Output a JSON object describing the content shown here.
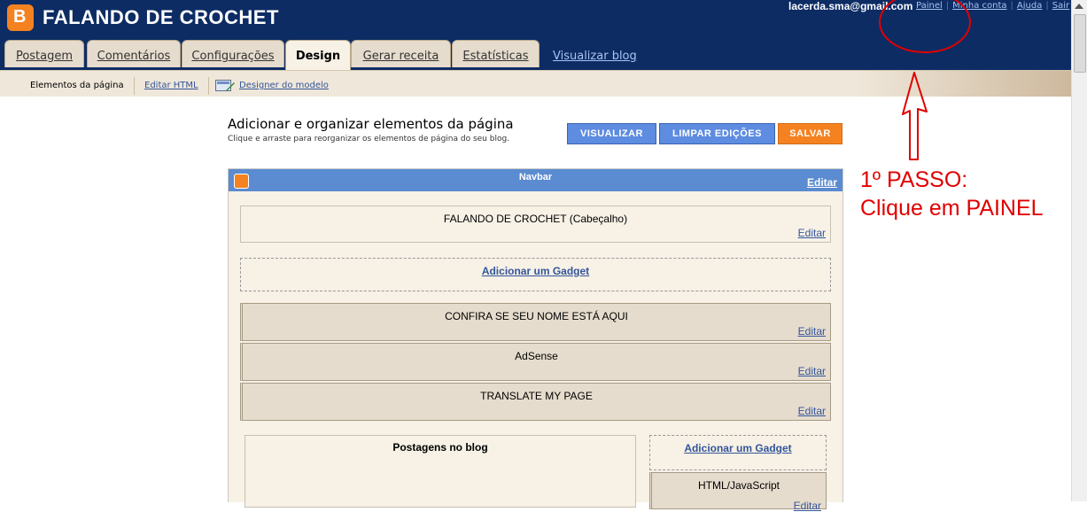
{
  "header": {
    "blog_title": "FALANDO DE CROCHET",
    "user_email": "lacerda.sma@gmail.com",
    "top_links": [
      "Painel",
      "Minha conta",
      "Ajuda",
      "Sair"
    ],
    "tabs": [
      "Postagem",
      "Comentários",
      "Configurações",
      "Design",
      "Gerar receita",
      "Estatísticas"
    ],
    "active_tab": "Design",
    "view_blog_link": "Visualizar blog"
  },
  "subnav": {
    "current": "Elementos da página",
    "links": [
      "Editar HTML",
      "Designer do modelo"
    ]
  },
  "page": {
    "title": "Adicionar e organizar elementos da página",
    "description": "Clique e arraste para reorganizar os elementos de página do seu blog.",
    "buttons": {
      "preview": "VISUALIZAR",
      "clear": "LIMPAR EDIÇÕES",
      "save": "SALVAR"
    }
  },
  "layout": {
    "navbar": {
      "title": "Navbar",
      "edit": "Editar"
    },
    "header_widget": {
      "title": "FALANDO DE CROCHET (Cabeçalho)",
      "edit": "Editar"
    },
    "add_gadget": "Adicionar um Gadget",
    "widgets": [
      {
        "title": "CONFIRA SE SEU NOME ESTÁ AQUI",
        "edit": "Editar"
      },
      {
        "title": "AdSense",
        "edit": "Editar"
      },
      {
        "title": "TRANSLATE MY PAGE",
        "edit": "Editar"
      }
    ],
    "main_posts": "Postagens no blog",
    "sidebar_add_gadget": "Adicionar um Gadget",
    "sidebar_widget": {
      "title": "HTML/JavaScript",
      "edit": "Editar"
    }
  },
  "annotation": {
    "line1": "1º PASSO:",
    "line2": "Clique  em PAINEL",
    "color": "#e00000"
  },
  "colors": {
    "header_bg": "#0d2c64",
    "accent_blue": "#5d8ce0",
    "accent_orange": "#f58220"
  }
}
